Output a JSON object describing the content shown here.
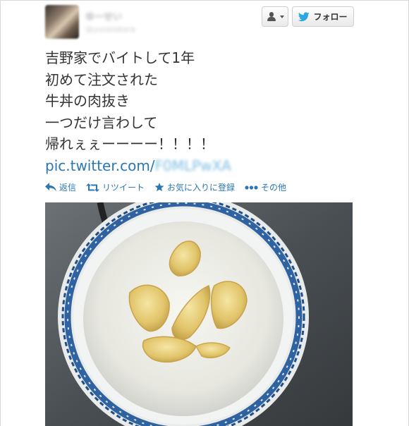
{
  "tweet": {
    "lines": [
      "吉野家でバイトして1年",
      "初めて注文された",
      "牛丼の肉抜き",
      "一つだけ言わして",
      "帰れぇぇーーーー！！！！"
    ],
    "link_prefix": "pic.twitter.com/",
    "link_suffix": "F0MLPwXA"
  },
  "author": {
    "display_name": "ゆーせい",
    "handle": "@yuseiokara"
  },
  "header": {
    "follow_label": "フォロー"
  },
  "icons": {
    "user_menu": "user-menu-icon",
    "follow": "twitter-bird-icon",
    "reply": "reply-icon",
    "retweet": "retweet-icon",
    "favorite": "star-icon",
    "more": "more-dots-icon"
  },
  "actions": {
    "reply": "返信",
    "retweet": "リツイート",
    "favorite": "お気に入りに登録",
    "more": "その他"
  },
  "colors": {
    "link": "#2a77b4",
    "follow_bird": "#2aa9e0",
    "text": "#333333"
  },
  "photo": {
    "subject": "rice bowl with onions only"
  }
}
